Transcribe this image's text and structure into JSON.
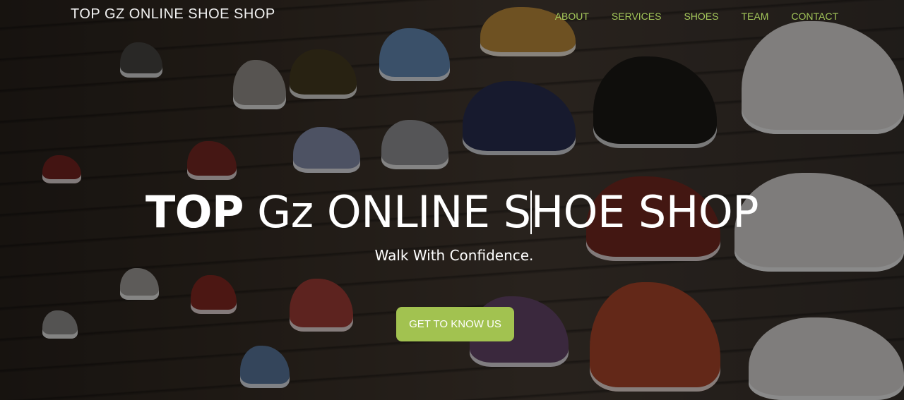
{
  "header": {
    "brand": "TOP GZ ONLINE SHOE SHOP",
    "nav": [
      "ABOUT",
      "SERVICES",
      "SHOES",
      "TEAM",
      "CONTACT"
    ]
  },
  "hero": {
    "title_bold": "TOP",
    "title_part1": "Gz ONLINE S",
    "title_part2": "HOE SHOP",
    "tagline": "Walk With Confidence.",
    "cta_label": "GET TO KNOW US"
  },
  "colors": {
    "nav_text": "#a4c85a",
    "cta_background": "#a2c250",
    "overlay": "rgba(0,0,0,0.45)"
  }
}
